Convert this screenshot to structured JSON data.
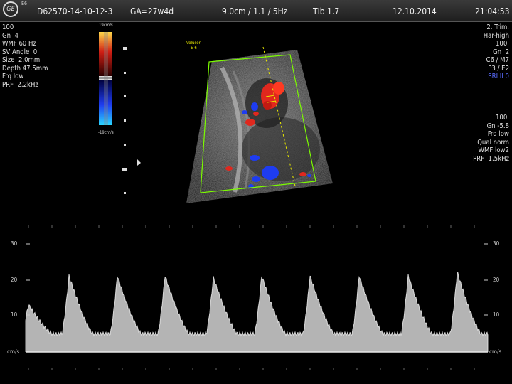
{
  "header": {
    "logo_text": "GE",
    "logo_sub": "E6",
    "patient_id": "D62570-14-10-12-3",
    "ga": "GA=27w4d",
    "probe_info": "9.0cm / 1.1 / 5Hz",
    "tib": "TIb 1.7",
    "date": "12.10.2014",
    "time": "21:04:53"
  },
  "left_params": [
    "100 ",
    "Gn  4",
    "WMF 60 Hz",
    "SV Angle  0",
    "Size  2.0mm",
    "Depth 47.5mm",
    "Frq low",
    "PRF  2.2kHz"
  ],
  "colorbar": {
    "top": "19cm/s",
    "bottom": "-19cm/s"
  },
  "right_params_top": [
    "2. Trim.",
    "Har-high",
    "100 ",
    "Gn  2",
    "C6 / M7",
    "P3 / E2"
  ],
  "right_params_blue": "SRI II 0",
  "right_params_bottom": [
    "100 ",
    "Gn -5.8",
    "Frq low",
    "Qual norm",
    "WMF low2",
    "PRF  1.5kHz"
  ],
  "volusion_label": "Voluson\nE 6",
  "sv_marker": "SV",
  "doppler_axis": {
    "ticks": [
      "30",
      "20",
      "10"
    ],
    "unit": "cm/s"
  },
  "colors": {
    "flow_red": "#e0281e",
    "flow_blue": "#1e3cf0",
    "roi": "#7cfc00",
    "cursor": "#e8e800"
  }
}
